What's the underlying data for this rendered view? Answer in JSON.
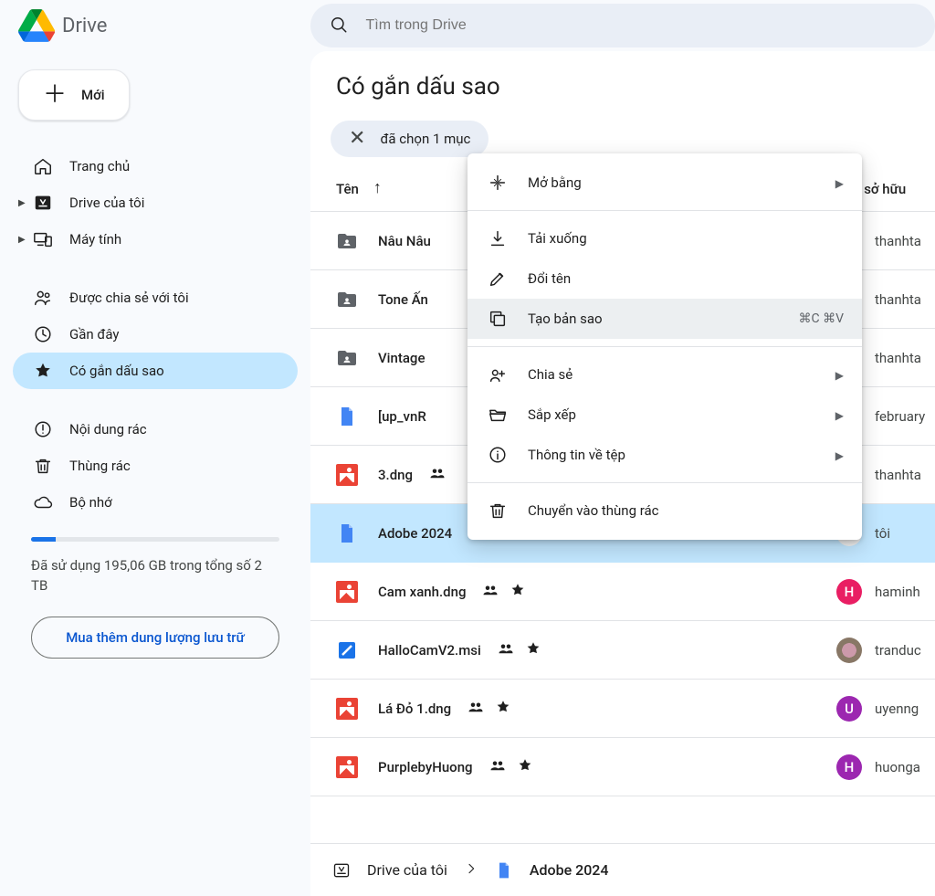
{
  "brand": "Drive",
  "search": {
    "placeholder": "Tìm trong Drive"
  },
  "newButton": {
    "label": "Mới"
  },
  "sidebar": {
    "items": [
      {
        "id": "home",
        "label": "Trang chủ",
        "icon": "home-icon"
      },
      {
        "id": "mydrive",
        "label": "Drive của tôi",
        "icon": "drive-square-icon",
        "expandable": true
      },
      {
        "id": "computers",
        "label": "Máy tính",
        "icon": "devices-icon",
        "expandable": true
      },
      {
        "id": "shared",
        "label": "Được chia sẻ với tôi",
        "icon": "people-icon"
      },
      {
        "id": "recent",
        "label": "Gần đây",
        "icon": "clock-icon"
      },
      {
        "id": "starred",
        "label": "Có gắn dấu sao",
        "icon": "star-icon",
        "active": true
      },
      {
        "id": "spam",
        "label": "Nội dung rác",
        "icon": "spam-icon"
      },
      {
        "id": "trash",
        "label": "Thùng rác",
        "icon": "trash-icon"
      },
      {
        "id": "storage",
        "label": "Bộ nhớ",
        "icon": "cloud-icon"
      }
    ]
  },
  "storage": {
    "usedFraction": 0.1,
    "text": "Đã sử dụng 195,06 GB trong tổng số 2 TB",
    "buy": "Mua thêm dung lượng lưu trữ"
  },
  "page": {
    "title": "Có gắn dấu sao",
    "selectionLabel": "đã chọn 1 mục",
    "columns": {
      "name": "Tên",
      "owner": "Chủ sở hữu"
    }
  },
  "files": [
    {
      "name": "Nâu Nâu",
      "type": "folder-shared",
      "owner": "thanhta",
      "avatarColor": "pink"
    },
    {
      "name": "Tone Ấn",
      "type": "folder-shared",
      "owner": "thanhta",
      "avatarColor": "pink"
    },
    {
      "name": "Vintage",
      "type": "folder-shared",
      "owner": "thanhta",
      "avatarColor": "pink"
    },
    {
      "name": "[up_vnR",
      "type": "doc",
      "owner": "february",
      "avatarColor": "purple"
    },
    {
      "name": "3.dng",
      "type": "image",
      "shared": true,
      "owner": "thanhta",
      "avatarColor": "pink"
    },
    {
      "name": "Adobe 2024",
      "type": "doc",
      "starred": true,
      "owner": "tôi",
      "avatarColor": "ai",
      "selected": true
    },
    {
      "name": "Cam xanh.dng",
      "type": "image",
      "shared": true,
      "starred": true,
      "owner": "haminh",
      "avatarColor": "pink",
      "avatarLetter": "H"
    },
    {
      "name": "HalloCamV2.msi",
      "type": "msi",
      "shared": true,
      "starred": true,
      "owner": "tranduc",
      "avatarColor": "img"
    },
    {
      "name": "Lá Đỏ 1.dng",
      "type": "image",
      "shared": true,
      "starred": true,
      "owner": "uyenng",
      "avatarColor": "purple",
      "avatarLetter": "U"
    },
    {
      "name": "PurplebyHuong",
      "type": "image",
      "shared": true,
      "starred": true,
      "owner": "huonga",
      "avatarColor": "purple",
      "avatarLetter": "H"
    }
  ],
  "breadcrumb": {
    "root": "Drive của tôi",
    "current": "Adobe 2024"
  },
  "contextMenu": {
    "items": [
      {
        "id": "openWith",
        "label": "Mở bằng",
        "icon": "open-with-icon",
        "submenu": true
      },
      {
        "sep": true
      },
      {
        "id": "download",
        "label": "Tải xuống",
        "icon": "download-icon"
      },
      {
        "id": "rename",
        "label": "Đổi tên",
        "icon": "rename-icon"
      },
      {
        "id": "copy",
        "label": "Tạo bản sao",
        "icon": "copy-icon",
        "shortcut": "⌘C ⌘V",
        "highlight": true
      },
      {
        "sep": true
      },
      {
        "id": "share",
        "label": "Chia sẻ",
        "icon": "share-icon",
        "submenu": true
      },
      {
        "id": "organize",
        "label": "Sắp xếp",
        "icon": "folder-open-icon",
        "submenu": true
      },
      {
        "id": "fileInfo",
        "label": "Thông tin về tệp",
        "icon": "info-icon",
        "submenu": true
      },
      {
        "sep": true
      },
      {
        "id": "trash",
        "label": "Chuyển vào thùng rác",
        "icon": "trash-icon"
      }
    ]
  }
}
